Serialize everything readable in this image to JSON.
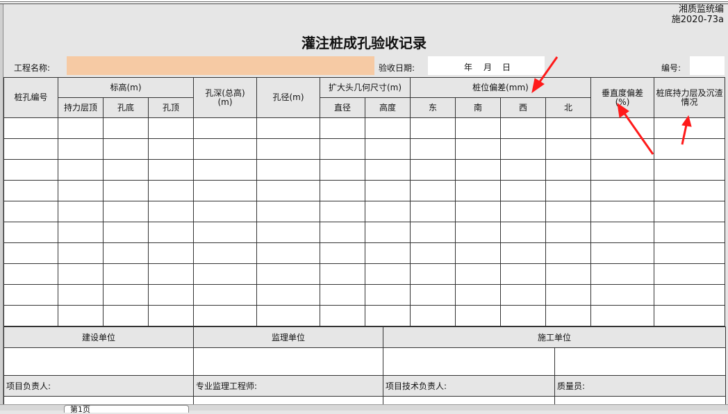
{
  "header": {
    "code_line1": "湘质监统编",
    "code_line2": "施2020-73a",
    "title": "灌注桩成孔验收记录",
    "project_label": "工程名称:",
    "project_value": "",
    "date_label": "验收日期:",
    "date_year": "年",
    "date_month": "月",
    "date_day": "日",
    "number_label": "编号:",
    "number_value": ""
  },
  "table": {
    "col_pile_no": "桩孔编号",
    "col_elevation": "标高(m)",
    "sub_bearing_top": "持力层顶",
    "sub_hole_bottom": "孔底",
    "sub_hole_top": "孔顶",
    "col_hole_depth": "孔深(总高)(m)",
    "col_hole_diameter": "孔径(m)",
    "col_enlarged_head": "扩大头几何尺寸(m)",
    "sub_diameter": "直径",
    "sub_height": "高度",
    "col_position_deviation": "桩位偏差(mm)",
    "sub_east": "东",
    "sub_south": "南",
    "sub_west": "西",
    "sub_north": "北",
    "col_verticality": "垂直度偏差(%)",
    "col_bearing_layer": "桩底持力层及沉渣情况"
  },
  "signoff": {
    "owner_unit": "建设单位",
    "supervisor_unit": "监理单位",
    "construction_unit": "施工单位",
    "project_leader": "项目负责人:",
    "supervising_engineer": "专业监理工程师:",
    "tech_leader": "项目技术负责人:",
    "quality_officer": "质量员:"
  },
  "sheet_tab": {
    "label": "第1页"
  },
  "colors": {
    "highlight": "#f6caa4",
    "arrow": "#ff1a1a",
    "background": "#e6e6e6"
  }
}
